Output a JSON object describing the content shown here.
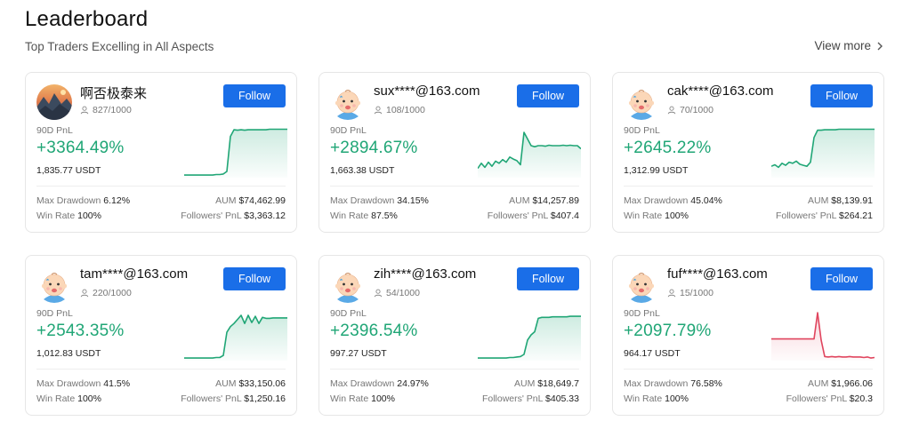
{
  "header": {
    "title": "Leaderboard",
    "subtitle": "Top Traders Excelling in All Aspects",
    "view_more": "View more"
  },
  "labels": {
    "pnl": "90D PnL",
    "follow": "Follow",
    "max_drawdown": "Max Drawdown",
    "win_rate": "Win Rate",
    "aum": "AUM",
    "followers_pnl": "Followers' PnL"
  },
  "colors": {
    "positive": "#20a676",
    "negative": "#e0455e",
    "button": "#1a6ee8"
  },
  "traders": [
    {
      "name": "啊否极泰来",
      "avatar": "landscape-avatar",
      "followers": "827/1000",
      "pnl_pct": "+3364.49%",
      "pnl_usdt": "1,835.77 USDT",
      "max_drawdown": "6.12%",
      "win_rate": "100%",
      "aum": "$74,462.99",
      "followers_pnl": "$3,363.12",
      "trend": "up",
      "spark": [
        0.05,
        0.05,
        0.05,
        0.05,
        0.05,
        0.05,
        0.05,
        0.05,
        0.05,
        0.06,
        0.06,
        0.07,
        0.12,
        0.8,
        0.93,
        0.92,
        0.93,
        0.92,
        0.93,
        0.93,
        0.93,
        0.93,
        0.93,
        0.93,
        0.94,
        0.94,
        0.94,
        0.94,
        0.94,
        0.94
      ]
    },
    {
      "name": "sux****@163.com",
      "avatar": "baby-avatar",
      "followers": "108/1000",
      "pnl_pct": "+2894.67%",
      "pnl_usdt": "1,663.38 USDT",
      "max_drawdown": "34.15%",
      "win_rate": "87.5%",
      "aum": "$14,257.89",
      "followers_pnl": "$407.4",
      "trend": "up",
      "spark": [
        0.18,
        0.28,
        0.2,
        0.3,
        0.22,
        0.32,
        0.28,
        0.35,
        0.3,
        0.4,
        0.36,
        0.33,
        0.25,
        0.88,
        0.75,
        0.62,
        0.6,
        0.62,
        0.62,
        0.61,
        0.63,
        0.62,
        0.62,
        0.62,
        0.63,
        0.62,
        0.63,
        0.62,
        0.62,
        0.56
      ]
    },
    {
      "name": "cak****@163.com",
      "avatar": "baby-avatar",
      "followers": "70/1000",
      "pnl_pct": "+2645.22%",
      "pnl_usdt": "1,312.99 USDT",
      "max_drawdown": "45.04%",
      "win_rate": "100%",
      "aum": "$8,139.91",
      "followers_pnl": "$264.21",
      "trend": "up",
      "spark": [
        0.22,
        0.25,
        0.2,
        0.28,
        0.24,
        0.3,
        0.28,
        0.32,
        0.26,
        0.24,
        0.22,
        0.3,
        0.78,
        0.92,
        0.92,
        0.93,
        0.93,
        0.93,
        0.93,
        0.94,
        0.94,
        0.94,
        0.94,
        0.94,
        0.94,
        0.94,
        0.94,
        0.94,
        0.94,
        0.94
      ]
    },
    {
      "name": "tam****@163.com",
      "avatar": "baby-avatar",
      "followers": "220/1000",
      "pnl_pct": "+2543.35%",
      "pnl_usdt": "1,012.83 USDT",
      "max_drawdown": "41.5%",
      "win_rate": "100%",
      "aum": "$33,150.06",
      "followers_pnl": "$1,250.16",
      "trend": "up",
      "spark": [
        0.05,
        0.05,
        0.05,
        0.05,
        0.05,
        0.05,
        0.05,
        0.05,
        0.05,
        0.06,
        0.06,
        0.1,
        0.55,
        0.66,
        0.72,
        0.8,
        0.88,
        0.72,
        0.88,
        0.74,
        0.86,
        0.72,
        0.84,
        0.82,
        0.82,
        0.83,
        0.83,
        0.83,
        0.83,
        0.83
      ]
    },
    {
      "name": "zih****@163.com",
      "avatar": "baby-avatar",
      "followers": "54/1000",
      "pnl_pct": "+2396.54%",
      "pnl_usdt": "997.27 USDT",
      "max_drawdown": "24.97%",
      "win_rate": "100%",
      "aum": "$18,649.7",
      "followers_pnl": "$405.33",
      "trend": "up",
      "spark": [
        0.05,
        0.05,
        0.05,
        0.05,
        0.05,
        0.05,
        0.05,
        0.05,
        0.05,
        0.06,
        0.06,
        0.07,
        0.08,
        0.12,
        0.4,
        0.5,
        0.56,
        0.82,
        0.84,
        0.84,
        0.84,
        0.85,
        0.85,
        0.85,
        0.85,
        0.85,
        0.86,
        0.86,
        0.86,
        0.86
      ]
    },
    {
      "name": "fuf****@163.com",
      "avatar": "baby-avatar",
      "followers": "15/1000",
      "pnl_pct": "+2097.79%",
      "pnl_usdt": "964.17 USDT",
      "max_drawdown": "76.58%",
      "win_rate": "100%",
      "aum": "$1,966.06",
      "followers_pnl": "$20.3",
      "trend": "down",
      "spark": [
        0.42,
        0.42,
        0.42,
        0.42,
        0.42,
        0.42,
        0.42,
        0.42,
        0.42,
        0.42,
        0.42,
        0.42,
        0.42,
        0.93,
        0.4,
        0.08,
        0.07,
        0.08,
        0.07,
        0.08,
        0.07,
        0.07,
        0.08,
        0.07,
        0.07,
        0.07,
        0.06,
        0.07,
        0.05,
        0.06
      ]
    }
  ]
}
